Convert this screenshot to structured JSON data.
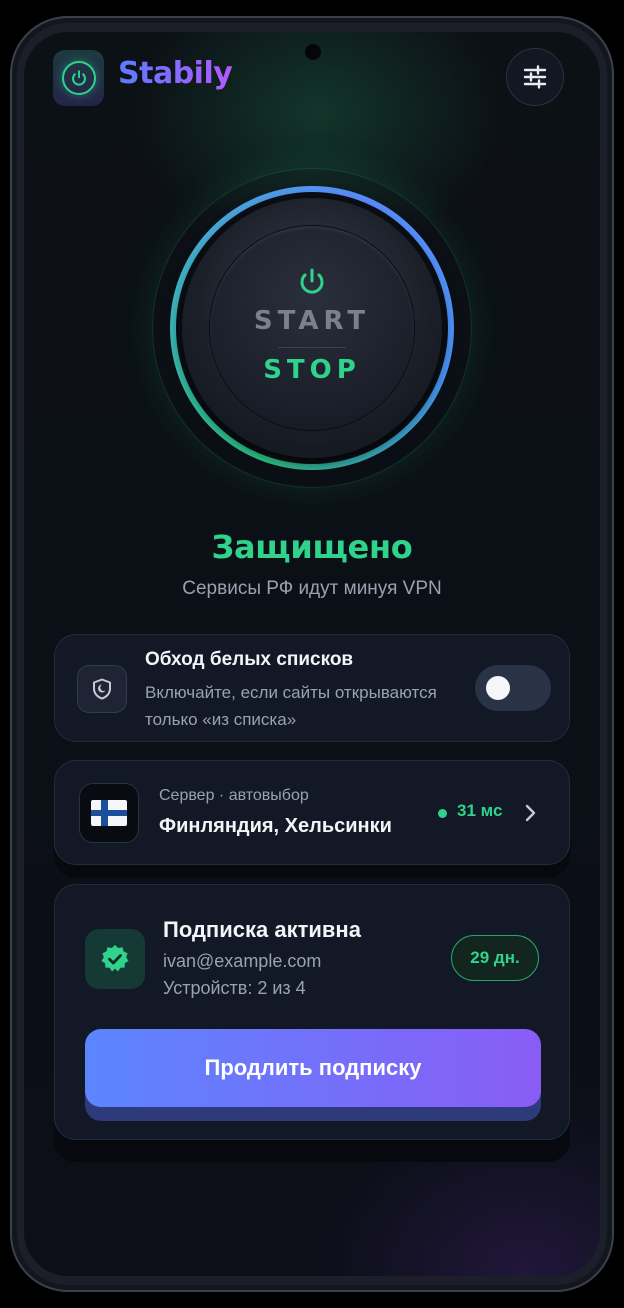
{
  "app": {
    "brand": "Stabily",
    "icons": {
      "logo": "power-icon",
      "settings": "sliders-icon"
    }
  },
  "power_button": {
    "start_label": "START",
    "stop_label": "STOP",
    "accent": "#2fd38c"
  },
  "status": {
    "title": "Защищено",
    "subtitle": "Сервисы РФ идут минуя VPN",
    "color": "#2fd38c"
  },
  "bypass": {
    "title": "Обход белых списков",
    "description": "Включайте, если сайты открываются только «из списка»",
    "toggle_on": false
  },
  "server": {
    "label": "Сервер · автовыбор",
    "name": "Финляндия, Хельсинки",
    "ping": "31 мс",
    "flag": "🇫🇮"
  },
  "subscription": {
    "title": "Подписка активна",
    "email": "ivan@example.com",
    "devices": "Устройств: 2 из 4",
    "days_left": "29 дн.",
    "renew_label": "Продлить подписку"
  }
}
